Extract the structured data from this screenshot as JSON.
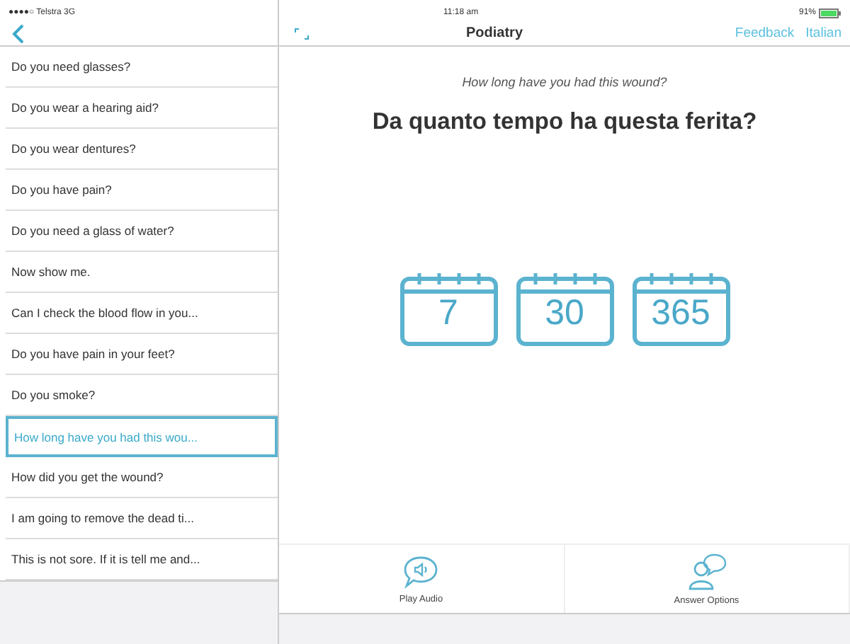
{
  "status_bar": {
    "carrier": "●●●●○ Telstra  3G",
    "time": "11:18 am",
    "battery": "91%"
  },
  "nav": {
    "title": "Podiatry",
    "actions": [
      "Feedback",
      "Italian"
    ]
  },
  "questions": [
    {
      "label": "Do you need glasses?",
      "selected": false
    },
    {
      "label": "Do you wear a hearing aid?",
      "selected": false
    },
    {
      "label": "Do you wear dentures?",
      "selected": false
    },
    {
      "label": "Do you have pain?",
      "selected": false
    },
    {
      "label": "Do you need a glass of water?",
      "selected": false
    },
    {
      "label": "Now show me.",
      "selected": false
    },
    {
      "label": "Can I check the blood flow in you...",
      "selected": false
    },
    {
      "label": "Do you have pain in your feet?",
      "selected": false
    },
    {
      "label": "Do you smoke?",
      "selected": false
    },
    {
      "label": "How long have you had this wou...",
      "selected": true
    },
    {
      "label": "How did you get the wound?",
      "selected": false
    },
    {
      "label": "I am going to remove the dead ti...",
      "selected": false
    },
    {
      "label": "This is not sore. If it is tell me and...",
      "selected": false
    }
  ],
  "question": {
    "english": "How long have you had this wound?",
    "translation": "Da quanto tempo ha questa ferita?"
  },
  "answers": [
    "7",
    "30",
    "365"
  ],
  "toolbar": [
    {
      "label": "Play Audio",
      "kind": "audio"
    },
    {
      "label": "Answer Options",
      "kind": "options"
    }
  ]
}
